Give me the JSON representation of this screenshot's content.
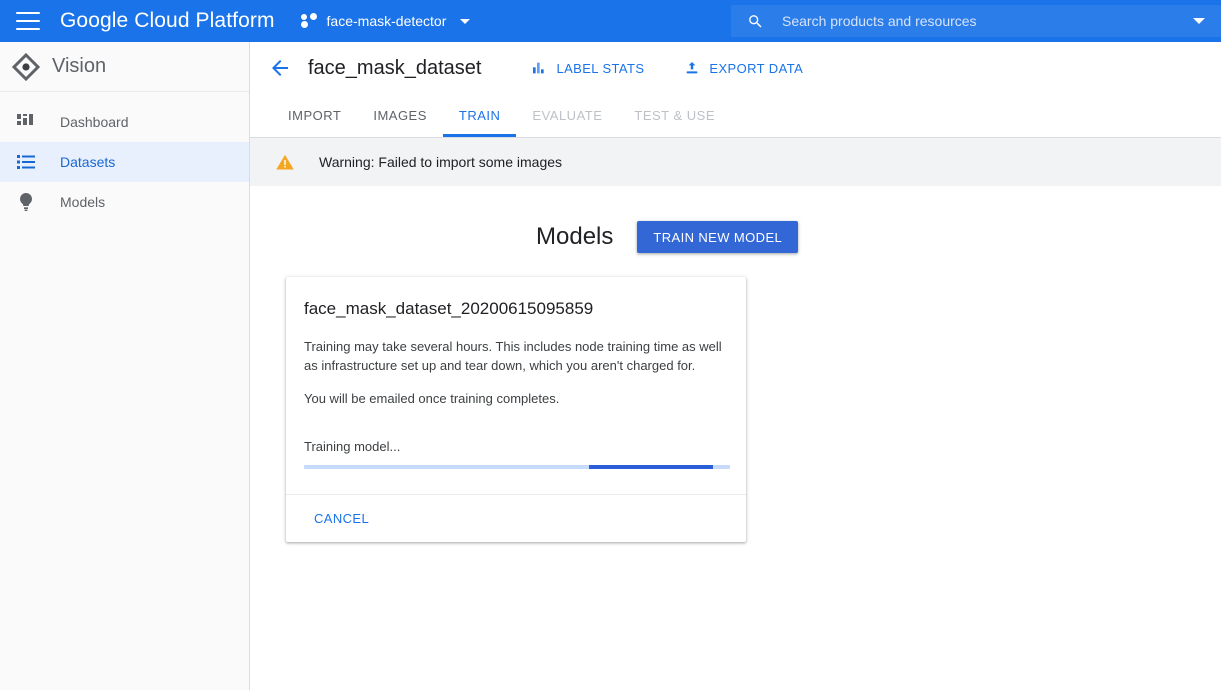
{
  "topbar": {
    "menu_icon": "hamburger-icon",
    "brand": "Google Cloud Platform",
    "project_icon": "project-dots-icon",
    "project_name": "face-mask-detector",
    "project_caret": "chevron-down-icon",
    "search": {
      "icon": "search-icon",
      "placeholder": "Search products and resources",
      "value": "",
      "caret": "chevron-down-icon"
    },
    "accent_color": "#1a73e8"
  },
  "sidebar": {
    "product_icon": "vision-diamond-icon",
    "product_name": "Vision",
    "items": [
      {
        "label": "Dashboard",
        "icon": "dashboard-icon",
        "active": false
      },
      {
        "label": "Datasets",
        "icon": "list-icon",
        "active": true
      },
      {
        "label": "Models",
        "icon": "bulb-icon",
        "active": false
      }
    ]
  },
  "page": {
    "back_icon": "back-arrow-icon",
    "title": "face_mask_dataset",
    "actions": [
      {
        "label": "LABEL STATS",
        "icon": "bar-chart-icon"
      },
      {
        "label": "EXPORT DATA",
        "icon": "upload-icon"
      }
    ],
    "tabs": [
      {
        "label": "IMPORT",
        "state": "normal"
      },
      {
        "label": "IMAGES",
        "state": "normal"
      },
      {
        "label": "TRAIN",
        "state": "active"
      },
      {
        "label": "EVALUATE",
        "state": "disabled"
      },
      {
        "label": "TEST & USE",
        "state": "disabled"
      }
    ],
    "warning": {
      "icon": "warning-triangle-icon",
      "text": "Warning: Failed to import some images",
      "color": "#f5a623",
      "background": "#f1f3f4"
    },
    "section_title": "Models",
    "train_button": "TRAIN NEW MODEL"
  },
  "model_card": {
    "title": "face_mask_dataset_20200615095859",
    "paragraph_1": "Training may take several hours. This includes node training time as well as infrastructure set up and tear down, which you aren't charged for.",
    "paragraph_2": "You will be emailed once training completes.",
    "progress_label": "Training model...",
    "progress": {
      "indeterminate": true,
      "segment_start_percent": 67,
      "segment_width_percent": 29,
      "track_color": "#c6dafc",
      "fill_color": "#2b5fd9"
    },
    "cancel_button": "CANCEL"
  }
}
